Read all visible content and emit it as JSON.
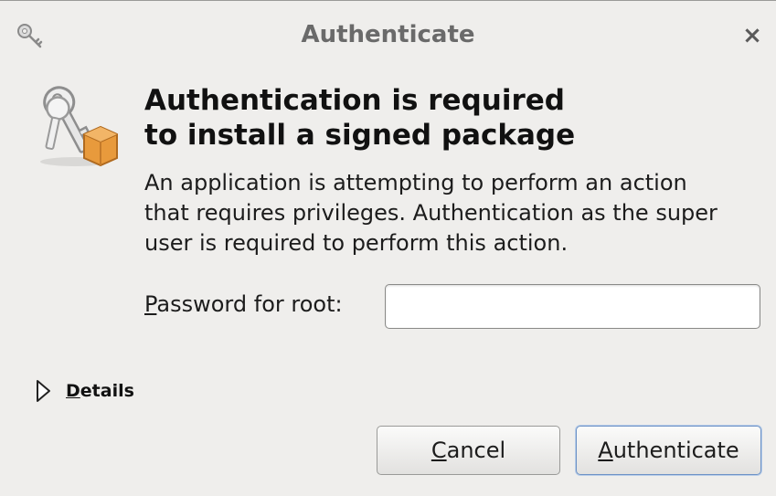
{
  "window": {
    "title": "Authenticate",
    "close_glyph": "×"
  },
  "icons": {
    "title_icon": "keys-icon",
    "dialog_icon": "keys-package-icon",
    "close_icon": "close-icon",
    "details_icon": "disclosure-triangle-icon"
  },
  "dialog": {
    "heading_line1": "Authentication is required",
    "heading_line2": "to install a signed package",
    "message_line1": "An application is attempting to perform an action",
    "message_line2": "that requires privileges. Authentication as the super",
    "message_line3": "user is required to perform this action."
  },
  "password": {
    "label_mnemonic": "P",
    "label_rest": "assword for root:",
    "value": "",
    "placeholder": ""
  },
  "details": {
    "label_mnemonic": "D",
    "label_rest": "etails"
  },
  "buttons": {
    "cancel_mnemonic": "C",
    "cancel_rest": "ancel",
    "auth_mnemonic": "A",
    "auth_rest": "uthenticate"
  },
  "colors": {
    "background": "#efeeec",
    "default_button_border": "#6d92c6",
    "package_orange": "#e89a3c"
  }
}
